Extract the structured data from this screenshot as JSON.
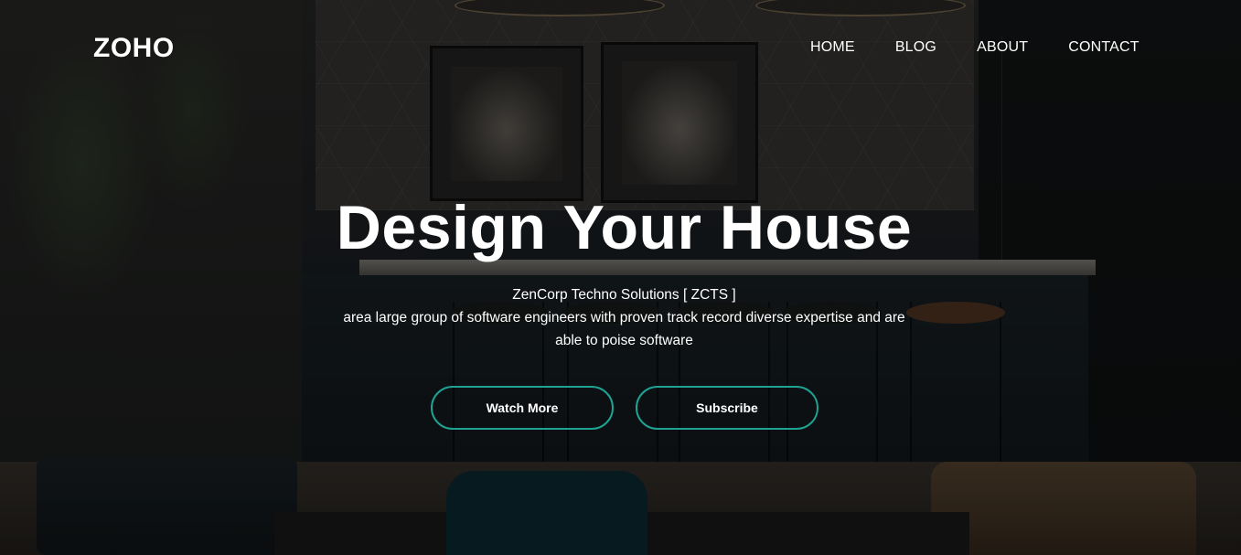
{
  "brand": {
    "logo": "ZOHO",
    "accent_color": "#1ea393"
  },
  "nav": {
    "items": [
      {
        "label": "HOME"
      },
      {
        "label": "BLOG"
      },
      {
        "label": "ABOUT"
      },
      {
        "label": "CONTACT"
      }
    ]
  },
  "hero": {
    "title": "Design Your House",
    "company": "ZenCorp Techno Solutions [ ZCTS ]",
    "description": "area large group of software engineers with proven track record diverse expertise and are able to poise software",
    "buttons": {
      "watch_more": "Watch More",
      "subscribe": "Subscribe"
    },
    "background_image": "kitchen-interior-photo"
  }
}
